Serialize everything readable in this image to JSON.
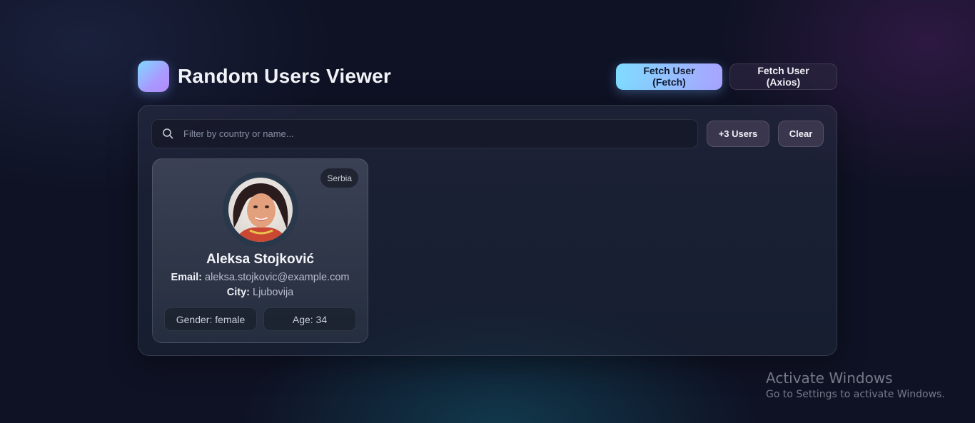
{
  "header": {
    "title": "Random Users Viewer",
    "fetch_button": "Fetch User (Fetch)",
    "axios_button": "Fetch User (Axios)"
  },
  "toolbar": {
    "search_placeholder": "Filter by country or name...",
    "search_value": "",
    "add_users_button": "+3 Users",
    "clear_button": "Clear"
  },
  "users": [
    {
      "country": "Serbia",
      "name": "Aleksa Stojković",
      "email_label": "Email:",
      "email": "aleksa.stojkovic@example.com",
      "city_label": "City:",
      "city": "Ljubovija",
      "gender": "Gender: female",
      "age": "Age: 34"
    }
  ],
  "watermark": {
    "title": "Activate Windows",
    "subtitle": "Go to Settings to activate Windows."
  },
  "colors": {
    "background": "#0f1224",
    "accent_start": "#7fdcff",
    "accent_end": "#a9a4ff"
  }
}
